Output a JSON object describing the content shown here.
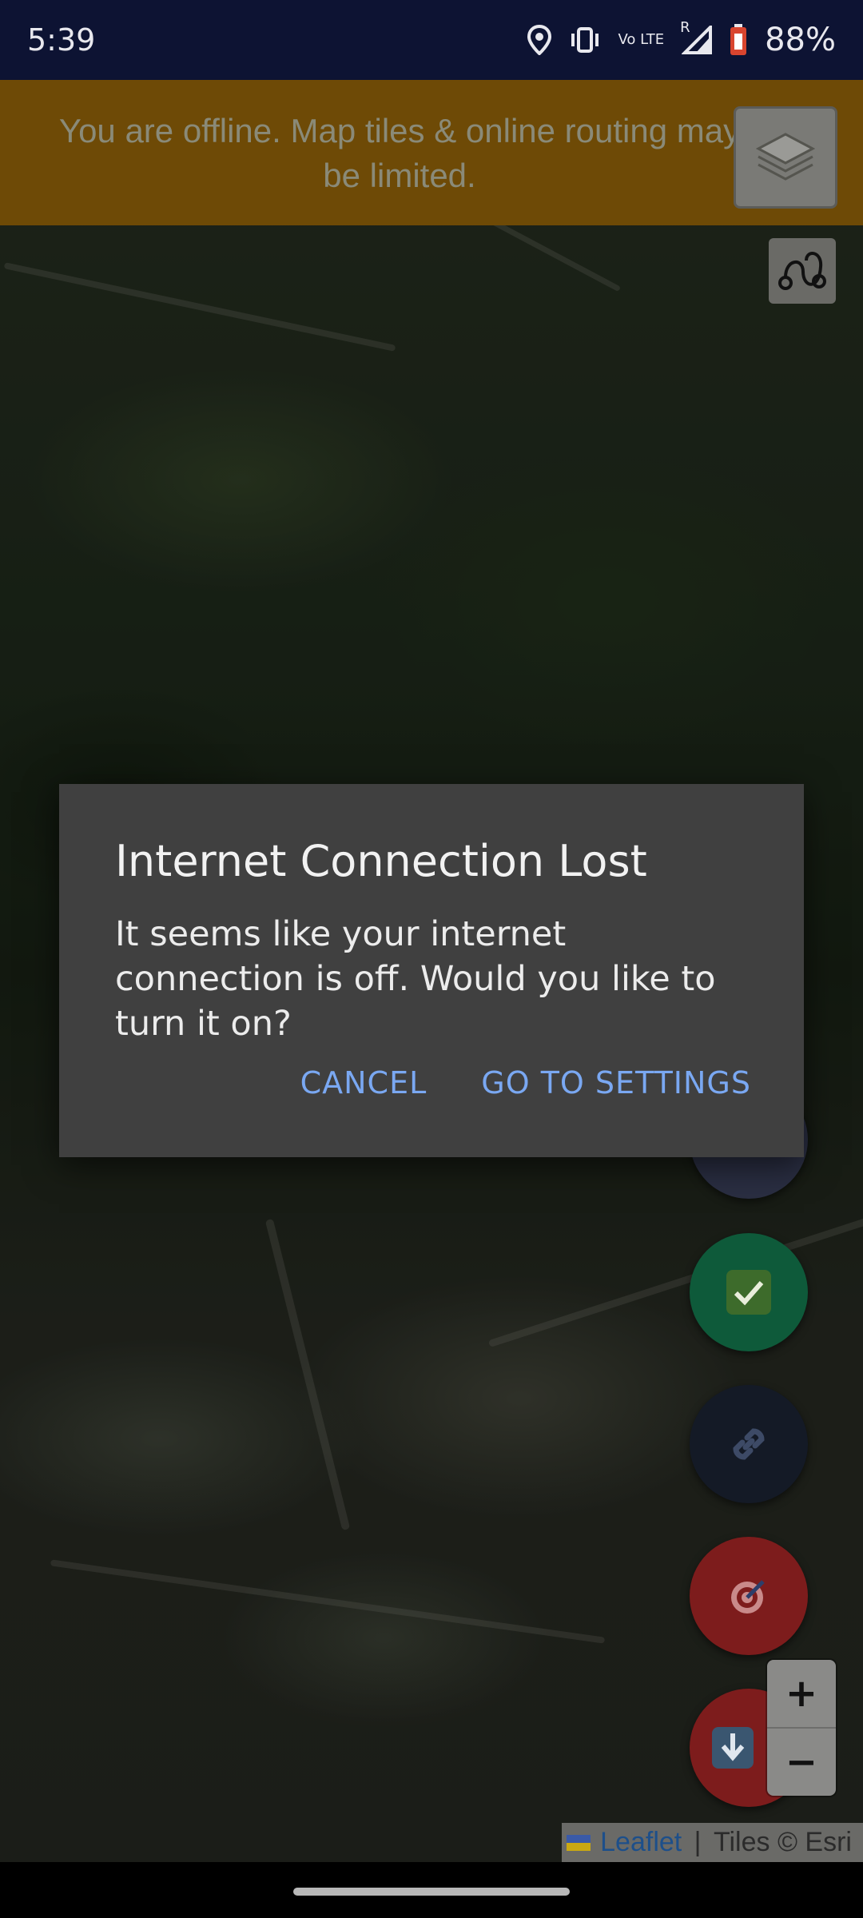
{
  "status_bar": {
    "time": "5:39",
    "icons": [
      "location-icon",
      "vibrate-icon",
      "volte-icon",
      "signal-icon",
      "battery-icon"
    ],
    "volte_label": "Vo LTE",
    "roaming_label": "R",
    "battery_percent": "88%"
  },
  "banner": {
    "text": "You are offline. Map tiles & online routing may be limited.",
    "color": "#6e4a06"
  },
  "map": {
    "attribution": {
      "leaflet": "Leaflet",
      "separator": " | ",
      "tiles": "Tiles © Esri"
    },
    "zoom": {
      "in": "+",
      "out": "−"
    }
  },
  "fabs": [
    {
      "name": "check-icon"
    },
    {
      "name": "link-icon"
    },
    {
      "name": "target-icon"
    },
    {
      "name": "download-icon"
    }
  ],
  "dialog": {
    "title": "Internet Connection Lost",
    "message": "It seems like your internet connection is off. Would you like to turn it on?",
    "cancel_label": "CANCEL",
    "settings_label": "GO TO SETTINGS",
    "accent": "#7aa8f2"
  }
}
